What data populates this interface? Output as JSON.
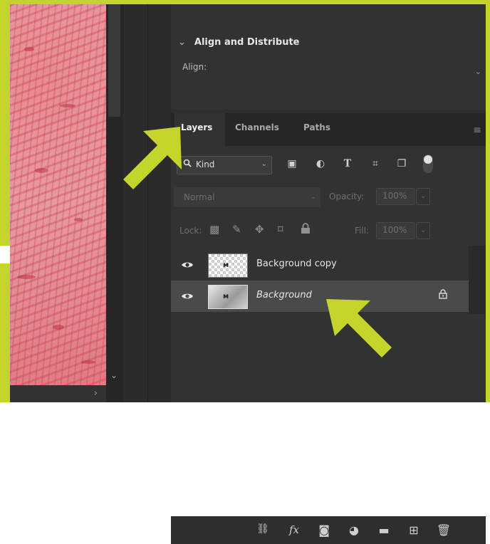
{
  "canvas": {
    "scroll_chevron": "›"
  },
  "scrollbar": {
    "chevron": "⌄"
  },
  "align": {
    "caret": "⌄",
    "title": "Align and Distribute",
    "subtitle": "Align:",
    "chevron": "⌄"
  },
  "tabs": [
    {
      "label": "Layers",
      "active": true
    },
    {
      "label": "Channels",
      "active": false
    },
    {
      "label": "Paths",
      "active": false
    }
  ],
  "panel_menu_icon": "≡",
  "filter": {
    "search_glyph": "🔍",
    "kind_label": "Kind",
    "chevron": "⌄",
    "icons": [
      "image-filter-icon",
      "adjustment-filter-icon",
      "type-filter-icon",
      "shape-filter-icon",
      "smart-object-filter-icon"
    ],
    "icon_glyphs": [
      "▣",
      "◐",
      "T",
      "⌗",
      "❐"
    ]
  },
  "blend": {
    "mode": "Normal",
    "chevron": "⌄"
  },
  "opacity": {
    "label": "Opacity:",
    "value": "100%",
    "chevron": "⌄"
  },
  "lock": {
    "label": "Lock:",
    "icons": [
      "lock-transparent-pixels-icon",
      "lock-image-pixels-icon",
      "lock-position-icon",
      "lock-artboard-icon",
      "lock-all-icon"
    ],
    "glyphs": [
      "▩",
      "✎",
      "✥",
      "⌑",
      "🔒"
    ]
  },
  "fill": {
    "label": "Fill:",
    "value": "100%",
    "chevron": "⌄"
  },
  "layers": [
    {
      "name": "Background copy",
      "selected": false,
      "italic": false,
      "transparent": true,
      "locked": false,
      "mark": "ᴍ"
    },
    {
      "name": "Background",
      "selected": true,
      "italic": true,
      "transparent": false,
      "locked": true,
      "mark": "ᴍ"
    }
  ],
  "eye_glyph": "👁",
  "lock_glyph": "🔒",
  "bottom_icons": {
    "names": [
      "link-layers-icon",
      "fx-icon",
      "add-mask-icon",
      "adjustment-layer-icon",
      "new-group-icon",
      "new-layer-icon",
      "delete-layer-icon"
    ],
    "glyphs": [
      "⛓",
      "fx",
      "◙",
      "◕",
      "▬",
      "⊞",
      "🗑"
    ]
  },
  "colors": {
    "annotation": "#c5d42a",
    "panel_bg": "#323232",
    "selected_row": "#4a4a4a"
  }
}
